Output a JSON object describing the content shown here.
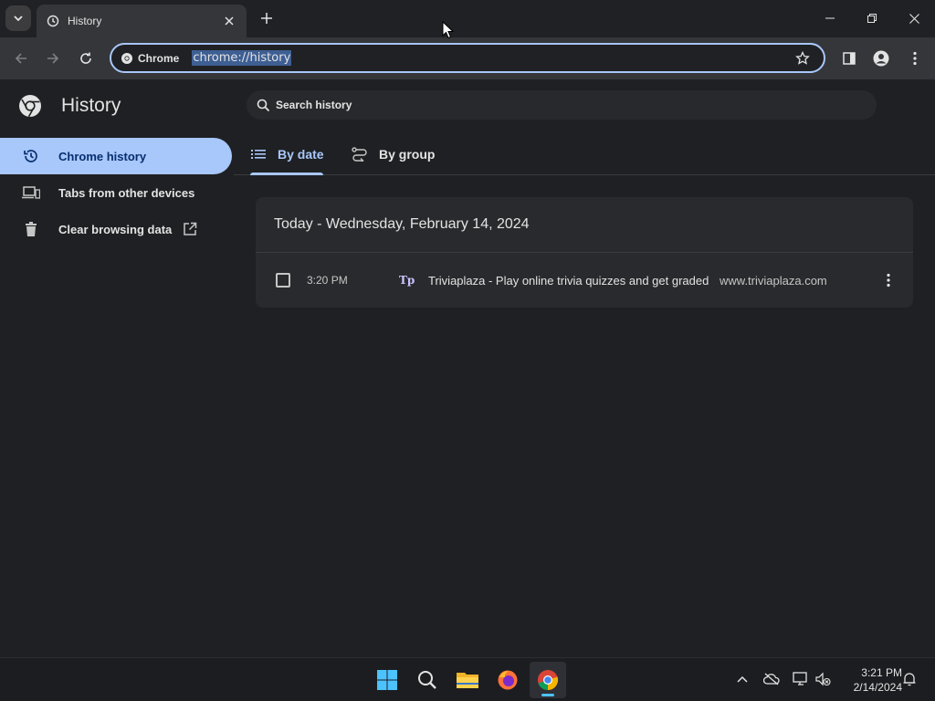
{
  "browser": {
    "tab_title": "History",
    "omnibox_chip": "Chrome",
    "url": "chrome://history"
  },
  "page": {
    "title": "History",
    "search_placeholder": "Search history",
    "sidebar": {
      "items": [
        {
          "label": "Chrome history",
          "icon": "history-icon",
          "active": true
        },
        {
          "label": "Tabs from other devices",
          "icon": "devices-icon",
          "active": false
        },
        {
          "label": "Clear browsing data",
          "icon": "trash-icon",
          "active": false
        }
      ]
    },
    "view_tabs": [
      {
        "label": "By date",
        "icon": "list-icon",
        "active": true
      },
      {
        "label": "By group",
        "icon": "journeys-icon",
        "active": false
      }
    ],
    "day_group": {
      "header": "Today - Wednesday, February 14, 2024",
      "entries": [
        {
          "time": "3:20 PM",
          "favicon_text": "Tp",
          "title": "Triviaplaza - Play online trivia quizzes and get graded",
          "domain": "www.triviaplaza.com"
        }
      ]
    }
  },
  "taskbar": {
    "apps": [
      "windows-start-icon",
      "search-icon",
      "file-explorer-icon",
      "firefox-icon",
      "chrome-icon"
    ],
    "time": "3:21 PM",
    "date": "2/14/2024"
  },
  "colors": {
    "accent": "#a8c7fa",
    "background": "#1f2023",
    "card": "#292a2d"
  }
}
